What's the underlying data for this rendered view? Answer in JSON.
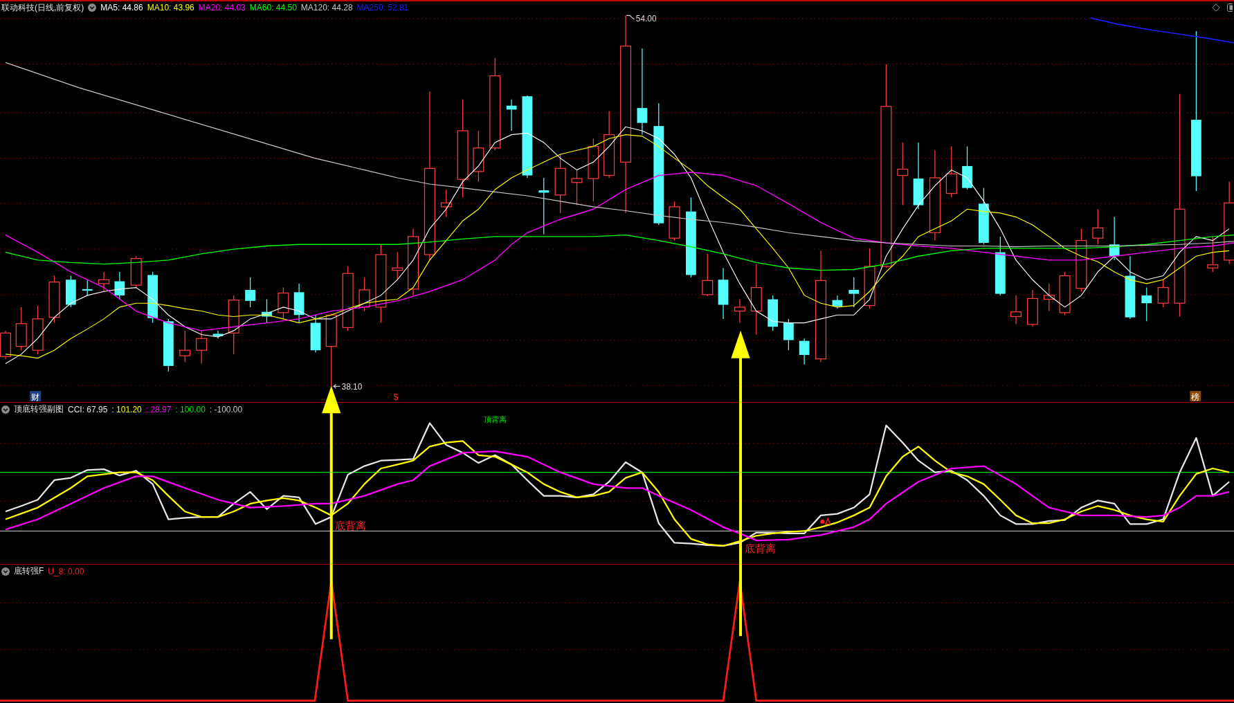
{
  "main_panel": {
    "title": "联动科技(日线,前复权)",
    "legend": [
      {
        "label": "MA5: 44.86",
        "color": "#ffffff"
      },
      {
        "label": "MA10: 43.96",
        "color": "#ffff00"
      },
      {
        "label": "MA20: 44.03",
        "color": "#ff00ff"
      },
      {
        "label": "MA60: 44.50",
        "color": "#00ff00"
      },
      {
        "label": "MA120: 44.28",
        "color": "#c8c8c8"
      },
      {
        "label": "MA250: 52.81",
        "color": "#1e1eff"
      }
    ],
    "high_label": "54.00",
    "low_label": "38.10",
    "event_tags": [
      {
        "text": "财",
        "kind": "finance"
      },
      {
        "text": "$",
        "kind": "dollar"
      },
      {
        "text": "榜",
        "kind": "ranking"
      }
    ]
  },
  "cci_panel": {
    "title": "顶底转强副图",
    "values": [
      {
        "text": "CCI: 67.95",
        "color": "#e6e6e6"
      },
      {
        "text": ": 101.20",
        "color": "#ffff00"
      },
      {
        "text": ": 28.97",
        "color": "#ff00ff"
      },
      {
        "text": ": 100.00",
        "color": "#00e600"
      },
      {
        "text": ": -100.00",
        "color": "#c8c8c8"
      }
    ],
    "signals": [
      {
        "text": "底背离",
        "kind": "bottom"
      },
      {
        "text": "顶背离",
        "kind": "top"
      },
      {
        "text": "底背离",
        "kind": "bottom"
      }
    ]
  },
  "signal_panel": {
    "title": "底转强F",
    "value": "U_8: 0.00"
  }
}
